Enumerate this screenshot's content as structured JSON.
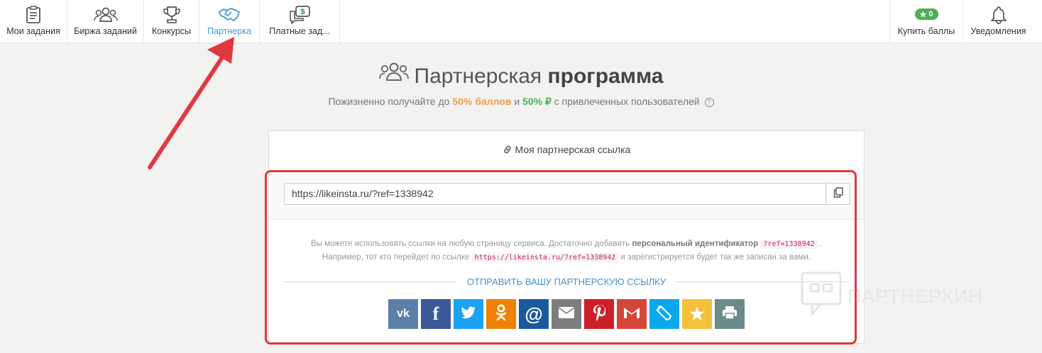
{
  "nav": {
    "items": [
      {
        "label": "Мои задания",
        "icon": "clipboard-icon"
      },
      {
        "label": "Биржа заданий",
        "icon": "users-icon"
      },
      {
        "label": "Конкурсы",
        "icon": "trophy-icon"
      },
      {
        "label": "Партнерка",
        "icon": "handshake-icon",
        "active": true
      },
      {
        "label": "Платные зад...",
        "icon": "dollar-chat-icon"
      }
    ],
    "buy": {
      "label": "Купить баллы",
      "badge": "0"
    },
    "notifications": {
      "label": "Уведомления"
    }
  },
  "page": {
    "title_light": "Партнерская",
    "title_bold": "программа",
    "subtitle_pre": "Пожизненно получайте до",
    "subtitle_pct1": "50% баллов",
    "subtitle_and": "и",
    "subtitle_pct2": "50% ₽",
    "subtitle_post": "с привлеченных пользователей",
    "help": "?"
  },
  "card": {
    "header": "Моя партнерская ссылка",
    "link_value": "https://likeinsta.ru/?ref=1338942",
    "info_line1_pre": "Вы можете использовать ссылки на любую страницу сервиса. Достаточно добавить",
    "info_line1_bold": "персональный идентификатор",
    "info_code1": "?ref=1338942",
    "info_line2_pre": "Например, тот кто перейдет по ссылке",
    "info_code2": "https://likeinsta.ru/?ref=1338942",
    "info_line2_post": "и зарегистрируется будет так же записан за вами.",
    "share_label": "ОТПРАВИТЬ ВАШУ ПАРТНЕРСКУЮ ССЫЛКУ"
  },
  "social": [
    {
      "name": "vk",
      "color": "#5b7fa6",
      "glyph": "vk"
    },
    {
      "name": "facebook",
      "color": "#3b5998",
      "glyph": "f"
    },
    {
      "name": "twitter",
      "color": "#1da1f2",
      "glyph": "tw"
    },
    {
      "name": "odnoklassniki",
      "color": "#ee8208",
      "glyph": "ok"
    },
    {
      "name": "mail-ru",
      "color": "#168de2",
      "glyph": "@"
    },
    {
      "name": "email",
      "color": "#7d7d7d",
      "glyph": "mail"
    },
    {
      "name": "pinterest",
      "color": "#cb2027",
      "glyph": "p"
    },
    {
      "name": "gmail",
      "color": "#d44638",
      "glyph": "M"
    },
    {
      "name": "livejournal",
      "color": "#0ca8ec",
      "glyph": "pen"
    },
    {
      "name": "favorites",
      "color": "#f3c13a",
      "glyph": "★"
    },
    {
      "name": "print",
      "color": "#6d8a8a",
      "glyph": "print"
    }
  ],
  "watermark": "ПАРТНЕРКИН",
  "colors": {
    "accent": "#3a9ad9",
    "annotation": "#e0383f",
    "orange": "#e8a04e",
    "green": "#4caf50"
  }
}
